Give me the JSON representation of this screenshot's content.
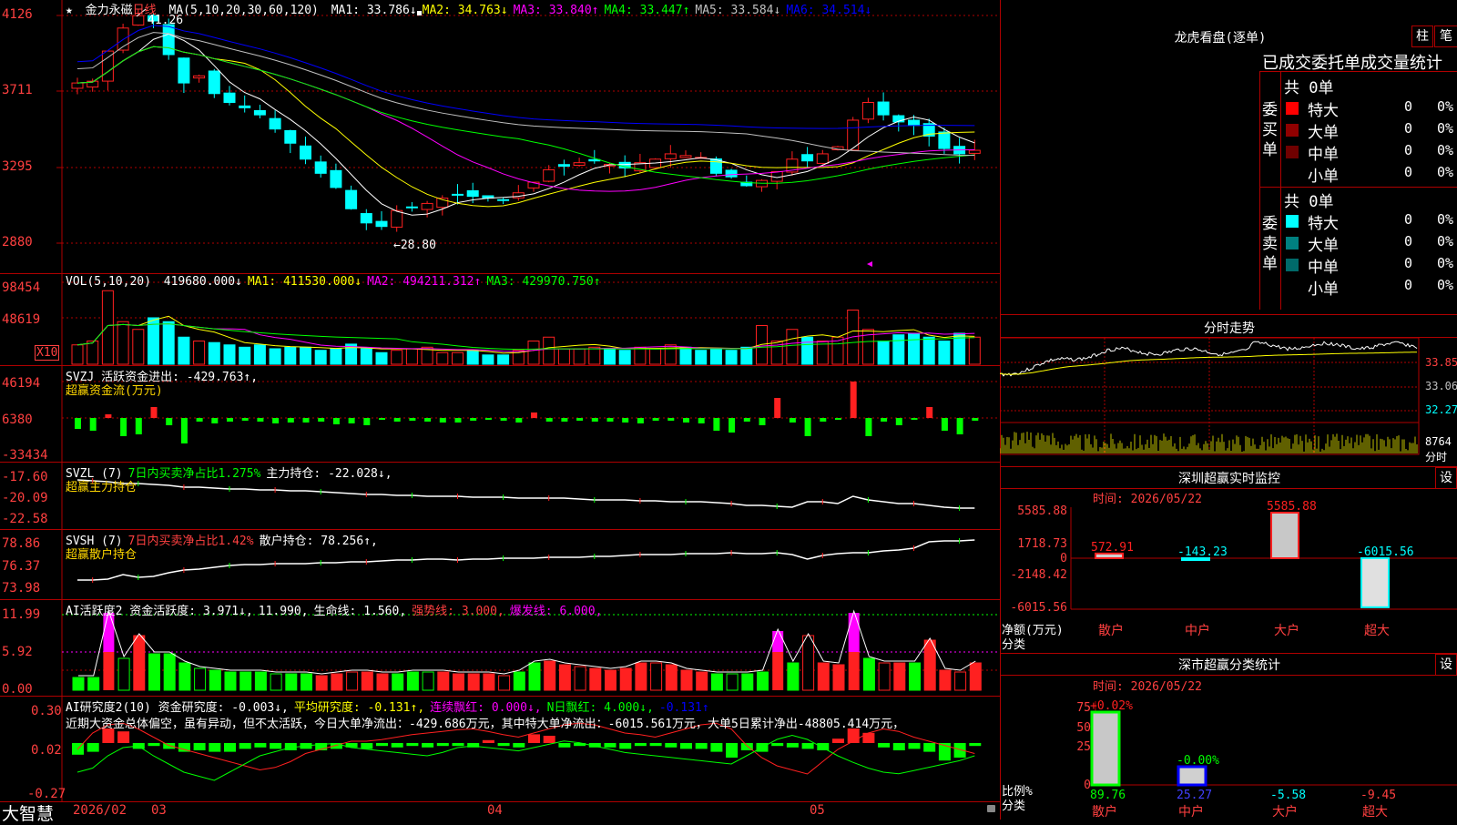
{
  "colors": {
    "up": "#ff2020",
    "down": "#00ffff",
    "ma1": "#ffffff",
    "ma2": "#ffff00",
    "ma3": "#ff00ff",
    "ma4": "#00ff00",
    "ma5": "#c0c0c0",
    "ma6": "#0000ff",
    "grid": "#b00000",
    "label_red": "#ff4040",
    "yellow": "#ffd700",
    "green": "#00ff00",
    "magenta": "#ff00ff",
    "cyan": "#00ffff"
  },
  "main": {
    "star_icon": "star-icon",
    "stock_name": "金力永磁",
    "period": "日线",
    "ma_header": "MA(5,10,20,30,60,120)",
    "ma_items": [
      {
        "label": "MA1: 33.786↓",
        "color": "#ffffff"
      },
      {
        "label": "MA2: 34.763↓",
        "color": "#ffff00"
      },
      {
        "label": "MA3: 33.840↑",
        "color": "#ff00ff"
      },
      {
        "label": "MA4: 33.447↑",
        "color": "#00ff00"
      },
      {
        "label": "MA5: 33.584↓",
        "color": "#c0c0c0"
      },
      {
        "label": "MA6: 34.514↓",
        "color": "#0000ff"
      }
    ],
    "y_labels": [
      "4126",
      "3711",
      "3295",
      "2880"
    ],
    "high_label": "41.26",
    "low_label": "←28.80"
  },
  "vol": {
    "header": "VOL(5,10,20)",
    "items": [
      {
        "label": "419680.000↓",
        "color": "#ffffff"
      },
      {
        "label": "MA1: 411530.000↓",
        "color": "#ffff00"
      },
      {
        "label": "MA2: 494211.312↑",
        "color": "#ff00ff"
      },
      {
        "label": "MA3: 429970.750↑",
        "color": "#00ff00"
      }
    ],
    "y_labels": [
      "98454",
      "48619"
    ],
    "unit": "X10"
  },
  "svzj": {
    "header": "SVZJ  活跃资金进出: -429.763↑,",
    "sub": "超赢资金流(万元)",
    "y_labels": [
      "46194",
      "6380",
      "-33434"
    ]
  },
  "svzl": {
    "header_a": "SVZL (7)",
    "header_b": "7日内买卖净占比1.275%",
    "header_c": "主力持仓: -22.028↓,",
    "sub": "超赢主力持仓",
    "y_labels": [
      "-17.60",
      "-20.09",
      "-22.58"
    ]
  },
  "svsh": {
    "header_a": "SVSH (7)",
    "header_b": "7日内买卖净占比1.42%",
    "header_c": "散户持仓: 78.256↑,",
    "sub": "超赢散户持仓",
    "y_labels": [
      "78.86",
      "76.37",
      "73.98"
    ]
  },
  "ai2": {
    "items": [
      {
        "label": "AI活跃度2 资金活跃度: 3.971↓,",
        "color": "#ffffff"
      },
      {
        "label": "11.990,",
        "color": "#ffffff"
      },
      {
        "label": "生命线: 1.560,",
        "color": "#ffffff"
      },
      {
        "label": "强势线: 3.000,",
        "color": "#ff4040"
      },
      {
        "label": "爆发线: 6.000,",
        "color": "#ff00ff"
      }
    ],
    "y_labels": [
      "11.99",
      "5.92",
      "0.00"
    ]
  },
  "ai3": {
    "items": [
      {
        "label": "AI研究度2(10) 资金研究度: -0.003↓,",
        "color": "#ffffff"
      },
      {
        "label": "平均研究度: -0.131↑,",
        "color": "#ffff00"
      },
      {
        "label": "连续飘红: 0.000↓,",
        "color": "#ff00ff"
      },
      {
        "label": "N日飘红: 4.000↓,",
        "color": "#00ff00"
      },
      {
        "label": "-0.131↑",
        "color": "#0000ff"
      }
    ],
    "comment": "近期大资金总体偏空，虽有异动，但不太活跃，今日大单净流出：-429.686万元，其中特大单净流出：-6015.561万元，大单5日累计净出-48805.414万元，",
    "y_labels": [
      "0.30",
      "0.02",
      "-0.27"
    ]
  },
  "bottom": {
    "logo": "大智慧",
    "dates": [
      "2026/02",
      "03",
      "04",
      "05"
    ]
  },
  "right": {
    "title": "龙虎看盘(逐单)",
    "btn_bar": "柱",
    "btn_pen": "笔",
    "tabs": "已成交委托单成交量统计",
    "buy_label": "委买单",
    "sell_label": "委卖单",
    "buy_total": "共 0单",
    "sell_total": "共 0单",
    "buy_rows": [
      {
        "name": "特大",
        "v1": "0",
        "v2": "0%",
        "color": "#ff0000"
      },
      {
        "name": "大单",
        "v1": "0",
        "v2": "0%",
        "color": "#900000"
      },
      {
        "name": "中单",
        "v1": "0",
        "v2": "0%",
        "color": "#700000"
      },
      {
        "name": "小单",
        "v1": "0",
        "v2": "0%",
        "color": "#000000"
      }
    ],
    "sell_rows": [
      {
        "name": "特大",
        "v1": "0",
        "v2": "0%",
        "color": "#00ffff"
      },
      {
        "name": "大单",
        "v1": "0",
        "v2": "0%",
        "color": "#008080"
      },
      {
        "name": "中单",
        "v1": "0",
        "v2": "0%",
        "color": "#006a6a"
      },
      {
        "name": "小单",
        "v1": "0",
        "v2": "0%",
        "color": "#000000"
      }
    ],
    "intraday_title": "分时走势",
    "intraday_labels": [
      "33.85",
      "33.06",
      "32.27"
    ],
    "intraday_vol_label": "8764",
    "intraday_vol_unit": "分时",
    "sz_monitor_title": "深圳超赢实时监控",
    "sz_time": "时间: 2026/05/22",
    "sz_set": "设",
    "sz_axis_label": "净额(万元)",
    "sz_axis_label2": "分类",
    "sz_y_labels": [
      "5585.88",
      "1718.73",
      "0",
      "-2148.42",
      "-6015.56"
    ],
    "sz_value_labels": [
      "572.91",
      "-143.23",
      "5585.88",
      "-6015.56"
    ],
    "categories": [
      "散户",
      "中户",
      "大户",
      "超大"
    ],
    "sz_stat_title": "深市超赢分类统计",
    "sz_stat_time": "时间: 2026/05/22",
    "sz_stat_set": "设",
    "stat_axis_label": "比例%",
    "stat_axis_label2": "分类",
    "stat_y_labels": [
      "75",
      "50",
      "25",
      "0"
    ],
    "stat_top_labels": [
      "+0.02%",
      "-0.00%"
    ],
    "stat_bottom_values": [
      "89.76",
      "25.27",
      "-5.58",
      "-9.45"
    ]
  },
  "chart_data": [
    {
      "type": "bar",
      "title": "深圳超赢实时监控",
      "categories": [
        "散户",
        "中户",
        "大户",
        "超大"
      ],
      "values": [
        572.91,
        -143.23,
        5585.88,
        -6015.56
      ],
      "ylabel": "净额(万元)",
      "ylim": [
        -6015.56,
        5585.88
      ]
    },
    {
      "type": "bar",
      "title": "深市超赢分类统计",
      "categories": [
        "散户",
        "中户",
        "大户",
        "超大"
      ],
      "values": [
        89.76,
        25.27,
        -5.58,
        -9.45
      ],
      "ylabel": "比例%",
      "ylim": [
        0,
        75
      ]
    }
  ]
}
